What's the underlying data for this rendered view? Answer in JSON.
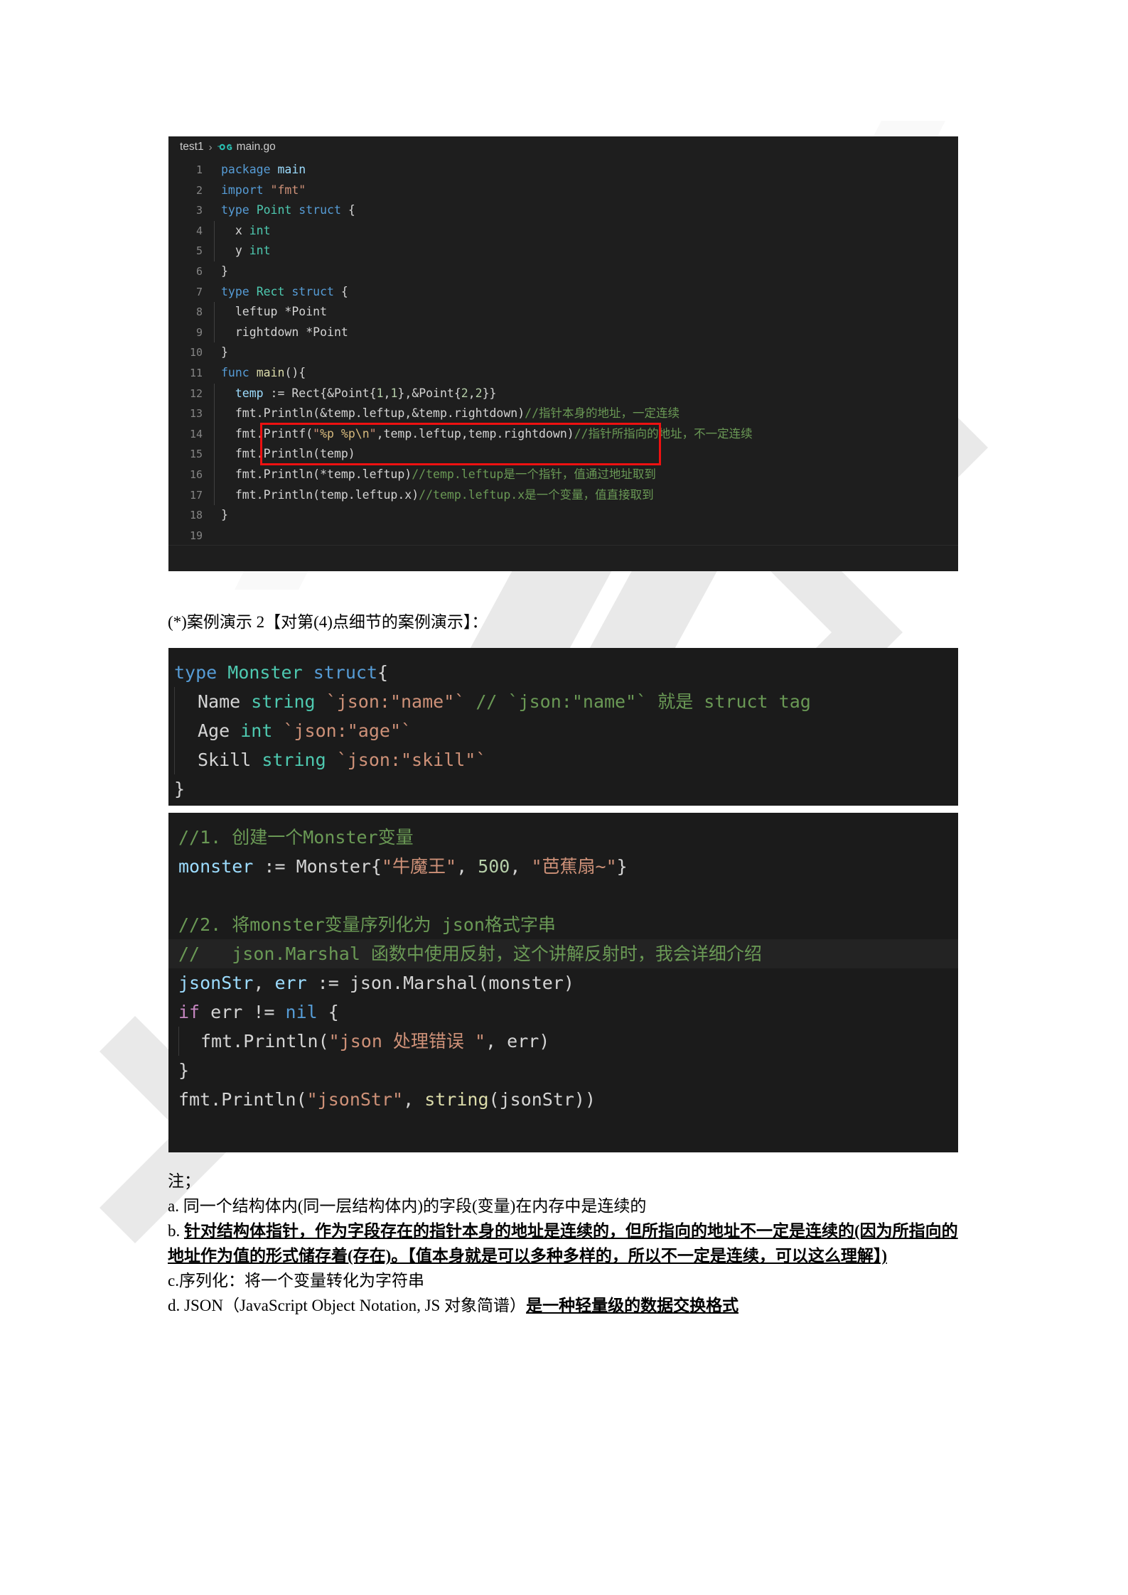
{
  "document": {
    "caption": "(*)案例演示 2【对第(4)点细节的案例演示】："
  },
  "editor": {
    "breadcrumb": {
      "project": "test1",
      "separator": "›",
      "file": "main.go",
      "icon": "go-language-icon"
    },
    "lines": [
      {
        "num": "1",
        "tokens": [
          {
            "t": "package",
            "c": "kw"
          },
          {
            "t": " ",
            "c": "pln"
          },
          {
            "t": "main",
            "c": "var"
          }
        ]
      },
      {
        "num": "2",
        "tokens": [
          {
            "t": "import",
            "c": "kw"
          },
          {
            "t": " ",
            "c": "pln"
          },
          {
            "t": "\"fmt\"",
            "c": "str"
          }
        ]
      },
      {
        "num": "3",
        "tokens": [
          {
            "t": "type",
            "c": "kw"
          },
          {
            "t": " ",
            "c": "pln"
          },
          {
            "t": "Point",
            "c": "typ"
          },
          {
            "t": " ",
            "c": "pln"
          },
          {
            "t": "struct",
            "c": "kw"
          },
          {
            "t": " {",
            "c": "pln"
          }
        ]
      },
      {
        "num": "4",
        "indent": true,
        "tokens": [
          {
            "t": "  x ",
            "c": "pln"
          },
          {
            "t": "int",
            "c": "typ"
          }
        ]
      },
      {
        "num": "5",
        "indent": true,
        "tokens": [
          {
            "t": "  y ",
            "c": "pln"
          },
          {
            "t": "int",
            "c": "typ"
          }
        ]
      },
      {
        "num": "6",
        "tokens": [
          {
            "t": "}",
            "c": "pln"
          }
        ]
      },
      {
        "num": "7",
        "tokens": [
          {
            "t": "type",
            "c": "kw"
          },
          {
            "t": " ",
            "c": "pln"
          },
          {
            "t": "Rect",
            "c": "typ"
          },
          {
            "t": " ",
            "c": "pln"
          },
          {
            "t": "struct",
            "c": "kw"
          },
          {
            "t": " {",
            "c": "pln"
          }
        ]
      },
      {
        "num": "8",
        "indent": true,
        "tokens": [
          {
            "t": "  leftup *Point",
            "c": "pln"
          }
        ]
      },
      {
        "num": "9",
        "indent": true,
        "tokens": [
          {
            "t": "  rightdown *Point",
            "c": "pln"
          }
        ]
      },
      {
        "num": "10",
        "tokens": [
          {
            "t": "}",
            "c": "pln"
          }
        ]
      },
      {
        "num": "11",
        "tokens": [
          {
            "t": "func",
            "c": "kw"
          },
          {
            "t": " ",
            "c": "pln"
          },
          {
            "t": "main",
            "c": "fn"
          },
          {
            "t": "(){",
            "c": "pln"
          }
        ]
      },
      {
        "num": "12",
        "indent": true,
        "tokens": [
          {
            "t": "  ",
            "c": "pln"
          },
          {
            "t": "temp",
            "c": "var"
          },
          {
            "t": " := Rect{&Point{",
            "c": "pln"
          },
          {
            "t": "1",
            "c": "num"
          },
          {
            "t": ",",
            "c": "pln"
          },
          {
            "t": "1",
            "c": "num"
          },
          {
            "t": "},&Point{",
            "c": "pln"
          },
          {
            "t": "2",
            "c": "num"
          },
          {
            "t": ",",
            "c": "pln"
          },
          {
            "t": "2",
            "c": "num"
          },
          {
            "t": "}}",
            "c": "pln"
          }
        ]
      },
      {
        "num": "13",
        "indent": true,
        "tokens": [
          {
            "t": "  fmt.",
            "c": "pln"
          },
          {
            "t": "Println",
            "c": "pln"
          },
          {
            "t": "(&temp.leftup,&temp.rightdown)",
            "c": "pln"
          },
          {
            "t": "//指针本身的地址，一定连续",
            "c": "cmt"
          }
        ]
      },
      {
        "num": "14",
        "indent": true,
        "tokens": [
          {
            "t": "  fmt.",
            "c": "pln"
          },
          {
            "t": "Printf",
            "c": "pln"
          },
          {
            "t": "(",
            "c": "pln"
          },
          {
            "t": "\"",
            "c": "str"
          },
          {
            "t": "%p %p",
            "c": "esc"
          },
          {
            "t": "\\n",
            "c": "esc"
          },
          {
            "t": "\"",
            "c": "str"
          },
          {
            "t": ",temp.leftup,temp.rightdown)",
            "c": "pln"
          },
          {
            "t": "//指针所指向的地址，不一定连续",
            "c": "cmt"
          }
        ]
      },
      {
        "num": "15",
        "indent": true,
        "tokens": [
          {
            "t": "  fmt.Println(temp)",
            "c": "pln"
          }
        ]
      },
      {
        "num": "16",
        "indent": true,
        "tokens": [
          {
            "t": "  fmt.Println(*temp.leftup)",
            "c": "pln"
          },
          {
            "t": "//temp.leftup是一个指针，值通过地址取到",
            "c": "cmt"
          }
        ]
      },
      {
        "num": "17",
        "indent": true,
        "tokens": [
          {
            "t": "  fmt.Println(temp.leftup.x)",
            "c": "pln"
          },
          {
            "t": "//temp.leftup.x是一个变量，值直接取到",
            "c": "cmt"
          }
        ]
      },
      {
        "num": "18",
        "tokens": [
          {
            "t": "}",
            "c": "pln"
          }
        ]
      },
      {
        "num": "19",
        "tokens": [
          {
            "t": "",
            "c": "pln"
          }
        ]
      }
    ],
    "annotation": {
      "name": "red-highlight-box",
      "color": "#ee1111",
      "covers_lines": [
        13,
        14
      ]
    }
  },
  "struct_block": {
    "lines": [
      {
        "indent": false,
        "tokens": [
          {
            "t": "type",
            "c": "kw"
          },
          {
            "t": " ",
            "c": "pln"
          },
          {
            "t": "Monster",
            "c": "typ"
          },
          {
            "t": " ",
            "c": "pln"
          },
          {
            "t": "struct",
            "c": "kw"
          },
          {
            "t": "{",
            "c": "pln"
          }
        ]
      },
      {
        "indent": true,
        "tokens": [
          {
            "t": "Name ",
            "c": "pln"
          },
          {
            "t": "string",
            "c": "typ"
          },
          {
            "t": " ",
            "c": "pln"
          },
          {
            "t": "`json:\"name\"`",
            "c": "str"
          },
          {
            "t": " ",
            "c": "pln"
          },
          {
            "t": "// `json:\"name\"` 就是 struct tag",
            "c": "cmt"
          }
        ]
      },
      {
        "indent": true,
        "tokens": [
          {
            "t": "Age ",
            "c": "pln"
          },
          {
            "t": "int",
            "c": "typ"
          },
          {
            "t": " ",
            "c": "pln"
          },
          {
            "t": "`json:\"age\"`",
            "c": "str"
          }
        ]
      },
      {
        "indent": true,
        "tokens": [
          {
            "t": "Skill ",
            "c": "pln"
          },
          {
            "t": "string",
            "c": "typ"
          },
          {
            "t": " ",
            "c": "pln"
          },
          {
            "t": "`json:\"skill\"`",
            "c": "str"
          }
        ]
      },
      {
        "indent": false,
        "tokens": [
          {
            "t": "}",
            "c": "pln"
          }
        ]
      }
    ]
  },
  "marshal_block": {
    "lines": [
      {
        "indent": false,
        "highlight": false,
        "tokens": [
          {
            "t": "//1. 创建一个Monster变量",
            "c": "cmt"
          }
        ]
      },
      {
        "indent": false,
        "highlight": false,
        "tokens": [
          {
            "t": "monster",
            "c": "var"
          },
          {
            "t": " := Monster{",
            "c": "pln"
          },
          {
            "t": "\"牛魔王\"",
            "c": "str"
          },
          {
            "t": ", ",
            "c": "pln"
          },
          {
            "t": "500",
            "c": "num"
          },
          {
            "t": ", ",
            "c": "pln"
          },
          {
            "t": "\"芭蕉扇~\"",
            "c": "str"
          },
          {
            "t": "}",
            "c": "pln"
          }
        ]
      },
      {
        "indent": false,
        "highlight": false,
        "tokens": [
          {
            "t": "",
            "c": "pln"
          }
        ]
      },
      {
        "indent": false,
        "highlight": false,
        "tokens": [
          {
            "t": "//2. 将monster变量序列化为 json格式字串",
            "c": "cmt"
          }
        ]
      },
      {
        "indent": false,
        "highlight": true,
        "tokens": [
          {
            "t": "//   json.Marshal 函数中使用反射，这个讲解反射时，我会详细介绍",
            "c": "cmt"
          }
        ]
      },
      {
        "indent": false,
        "highlight": false,
        "tokens": [
          {
            "t": "jsonStr",
            "c": "var"
          },
          {
            "t": ", ",
            "c": "pln"
          },
          {
            "t": "err",
            "c": "var"
          },
          {
            "t": " := json.",
            "c": "pln"
          },
          {
            "t": "Marshal",
            "c": "pln"
          },
          {
            "t": "(monster)",
            "c": "pln"
          }
        ]
      },
      {
        "indent": false,
        "highlight": false,
        "tokens": [
          {
            "t": "if",
            "c": "ctl"
          },
          {
            "t": " err != ",
            "c": "pln"
          },
          {
            "t": "nil",
            "c": "kw"
          },
          {
            "t": " {",
            "c": "pln"
          }
        ]
      },
      {
        "indent": true,
        "highlight": false,
        "tokens": [
          {
            "t": "fmt.Println(",
            "c": "pln"
          },
          {
            "t": "\"json 处理错误 \"",
            "c": "str"
          },
          {
            "t": ", err)",
            "c": "pln"
          }
        ]
      },
      {
        "indent": false,
        "highlight": false,
        "tokens": [
          {
            "t": "}",
            "c": "pln"
          }
        ]
      },
      {
        "indent": false,
        "highlight": false,
        "tokens": [
          {
            "t": "fmt.Println(",
            "c": "pln"
          },
          {
            "t": "\"jsonStr\"",
            "c": "str"
          },
          {
            "t": ", ",
            "c": "pln"
          },
          {
            "t": "string",
            "c": "fn"
          },
          {
            "t": "(jsonStr))",
            "c": "pln"
          }
        ]
      }
    ]
  },
  "notes": {
    "header": "注；",
    "items": [
      {
        "id": "a",
        "segments": [
          {
            "text": "a. 同一个结构体内(同一层结构体内)的字段(变量)在内存中是连续的",
            "style": "plain"
          }
        ]
      },
      {
        "id": "b",
        "segments": [
          {
            "text": "b. ",
            "style": "plain"
          },
          {
            "text": "针对结构体指针，作为字段存在的指针本身的地址是连续的，但所指向的地址不一定是连续的(因为所指向的地址作为值的形式储存着(存在)。【值本身就是可以多种多样的，所以不一定是连续，可以这么理解】)",
            "style": "bold-underline"
          }
        ]
      },
      {
        "id": "c",
        "segments": [
          {
            "text": "c.序列化：将一个变量转化为字符串",
            "style": "plain"
          }
        ]
      },
      {
        "id": "d",
        "segments": [
          {
            "text": "d. JSON（JavaScript Object Notation, JS 对象简谱）",
            "style": "plain"
          },
          {
            "text": "是一种轻量级的数据交换格式",
            "style": "bold-underline"
          }
        ]
      }
    ]
  },
  "colors": {
    "editor_background": "#1e1e1e",
    "code_background": "#1b1b1b",
    "annotation_red": "#ee1111",
    "keyword_blue": "#569cd6",
    "type_green": "#4ec9b0",
    "string_orange": "#ce9178",
    "comment_green": "#6a9955",
    "variable_blue": "#9cdcfe",
    "line_number_gray": "#858585",
    "watermark_gray": "#e8e8e8"
  }
}
